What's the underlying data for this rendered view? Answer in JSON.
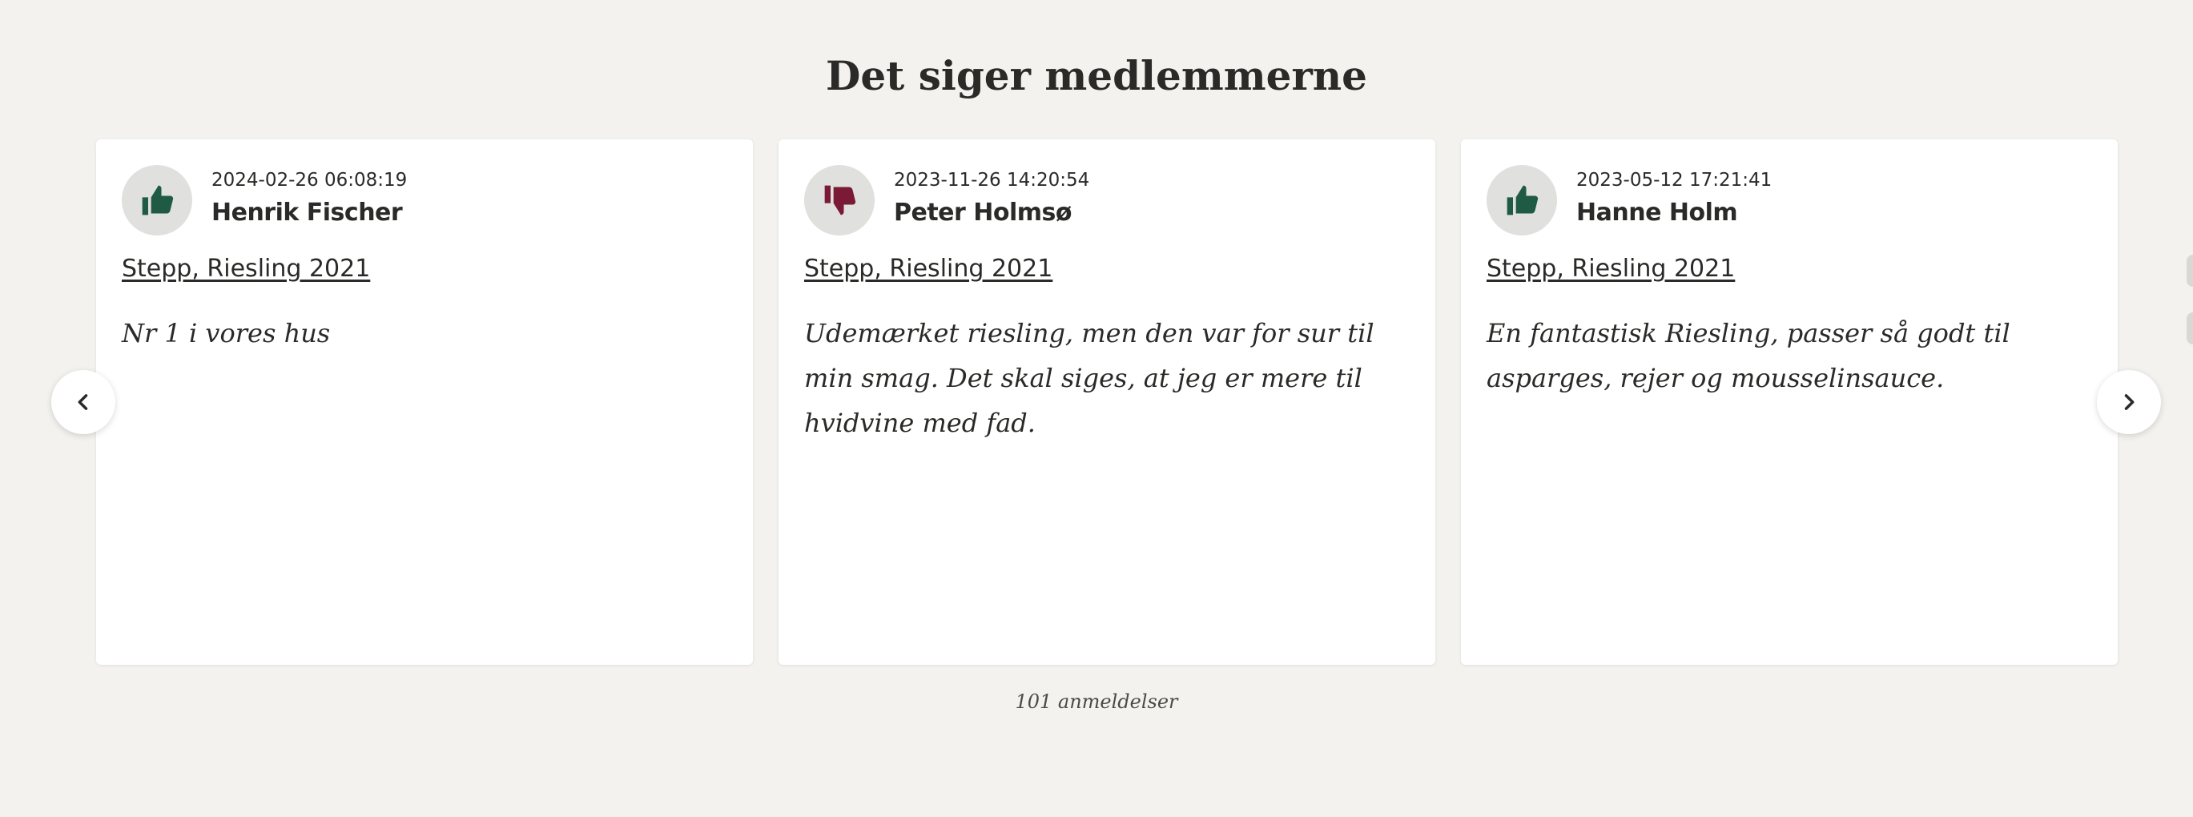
{
  "section": {
    "title": "Det siger medlemmerne",
    "count_text": "101 anmeldelser"
  },
  "colors": {
    "background": "#f3f2ef",
    "thumb_up": "#1f5a44",
    "thumb_down": "#7a1a34",
    "text": "#2a2a28"
  },
  "reviews": [
    {
      "date": "2024-02-26 06:08:19",
      "author": "Henrik Fischer",
      "wine": "Stepp, Riesling 2021",
      "text": "Nr 1 i vores hus",
      "rating_icon": "thumbs-up-icon"
    },
    {
      "date": "2023-11-26 14:20:54",
      "author": "Peter Holmsø",
      "wine": "Stepp, Riesling 2021",
      "text": "Udemærket riesling, men den var for sur til min smag. Det skal siges, at jeg er mere til hvidvine med fad.",
      "rating_icon": "thumbs-down-icon"
    },
    {
      "date": "2023-05-12 17:21:41",
      "author": "Hanne Holm",
      "wine": "Stepp, Riesling 2021",
      "text": "En fantastisk Riesling, passer så godt til asparges, rejer og mousselinsauce.",
      "rating_icon": "thumbs-up-icon"
    }
  ],
  "carousel": {
    "prev_icon": "chevron-left-icon",
    "next_icon": "chevron-right-icon"
  }
}
